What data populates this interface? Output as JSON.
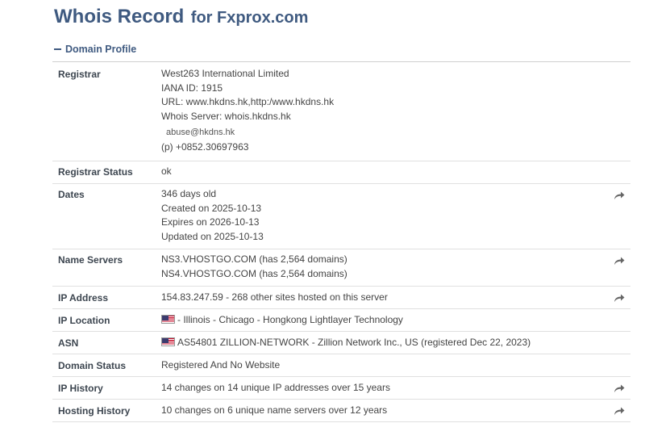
{
  "header": {
    "title": "Whois Record",
    "subtitle": "for Fxprox.com"
  },
  "section": {
    "label": "Domain Profile"
  },
  "rows": {
    "registrar": {
      "label": "Registrar",
      "lines": [
        "West263 International Limited",
        "IANA ID: 1915",
        "URL: www.hkdns.hk,http:/www.hkdns.hk",
        "Whois Server: whois.hkdns.hk"
      ],
      "email": "abuse@hkdns.hk",
      "phone": "(p) +0852.30697963"
    },
    "registrar_status": {
      "label": "Registrar Status",
      "value": "ok"
    },
    "dates": {
      "label": "Dates",
      "lines": [
        "346 days old",
        "Created on 2025-10-13",
        "Expires on 2026-10-13",
        "Updated on 2025-10-13"
      ]
    },
    "name_servers": {
      "label": "Name Servers",
      "lines": [
        "NS3.VHOSTGO.COM (has 2,564 domains)",
        "NS4.VHOSTGO.COM (has 2,564 domains)"
      ]
    },
    "ip_address": {
      "label": "IP Address",
      "value": "154.83.247.59 - 268 other sites hosted on this server"
    },
    "ip_location": {
      "label": "IP Location",
      "value": "- Illinois - Chicago - Hongkong Lightlayer Technology"
    },
    "asn": {
      "label": "ASN",
      "value": "AS54801 ZILLION-NETWORK - Zillion Network Inc., US (registered Dec 22, 2023)"
    },
    "domain_status": {
      "label": "Domain Status",
      "value": "Registered And No Website"
    },
    "ip_history": {
      "label": "IP History",
      "value": "14 changes on 14 unique IP addresses over 15 years"
    },
    "hosting_history": {
      "label": "Hosting History",
      "value": "10 changes on 6 unique name servers over 12 years"
    }
  },
  "icons": {
    "share": "share-arrow-icon",
    "flag": "us-flag-icon"
  },
  "colors": {
    "title": "#3f5a80",
    "icon": "#666666"
  }
}
